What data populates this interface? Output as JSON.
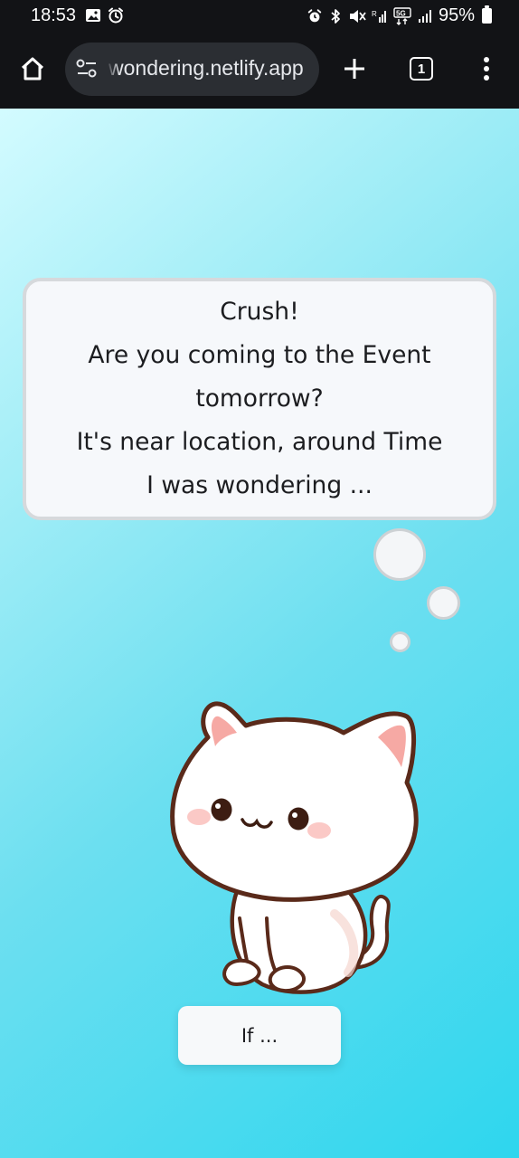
{
  "status_bar": {
    "time": "18:53",
    "battery_percent": "95%",
    "left_icons": [
      "image-icon",
      "alarm-icon"
    ],
    "right_icons": [
      "alarm-icon",
      "bluetooth-icon",
      "mute-icon",
      "signal-icon",
      "5g-icon",
      "signal-icon",
      "battery-icon"
    ]
  },
  "browser": {
    "url": "wondering.netlify.app",
    "tab_count": "1",
    "icons": [
      "home-icon",
      "site-settings-icon",
      "plus-icon",
      "tabs-icon",
      "more-vert-icon"
    ]
  },
  "message": {
    "lines": [
      "Crush!",
      "Are you coming to the Event",
      "tomorrow?",
      "It's near location, around Time",
      "I was wondering ..."
    ]
  },
  "button": {
    "label": "If ..."
  },
  "colors": {
    "page_gradient_start": "#d3fbff",
    "page_gradient_end": "#2ed6ee",
    "bubble_bg": "#f6f8fb",
    "bubble_border": "#d6d9dc",
    "chrome_bg": "#121316",
    "url_pill_bg": "#2b2e33"
  }
}
